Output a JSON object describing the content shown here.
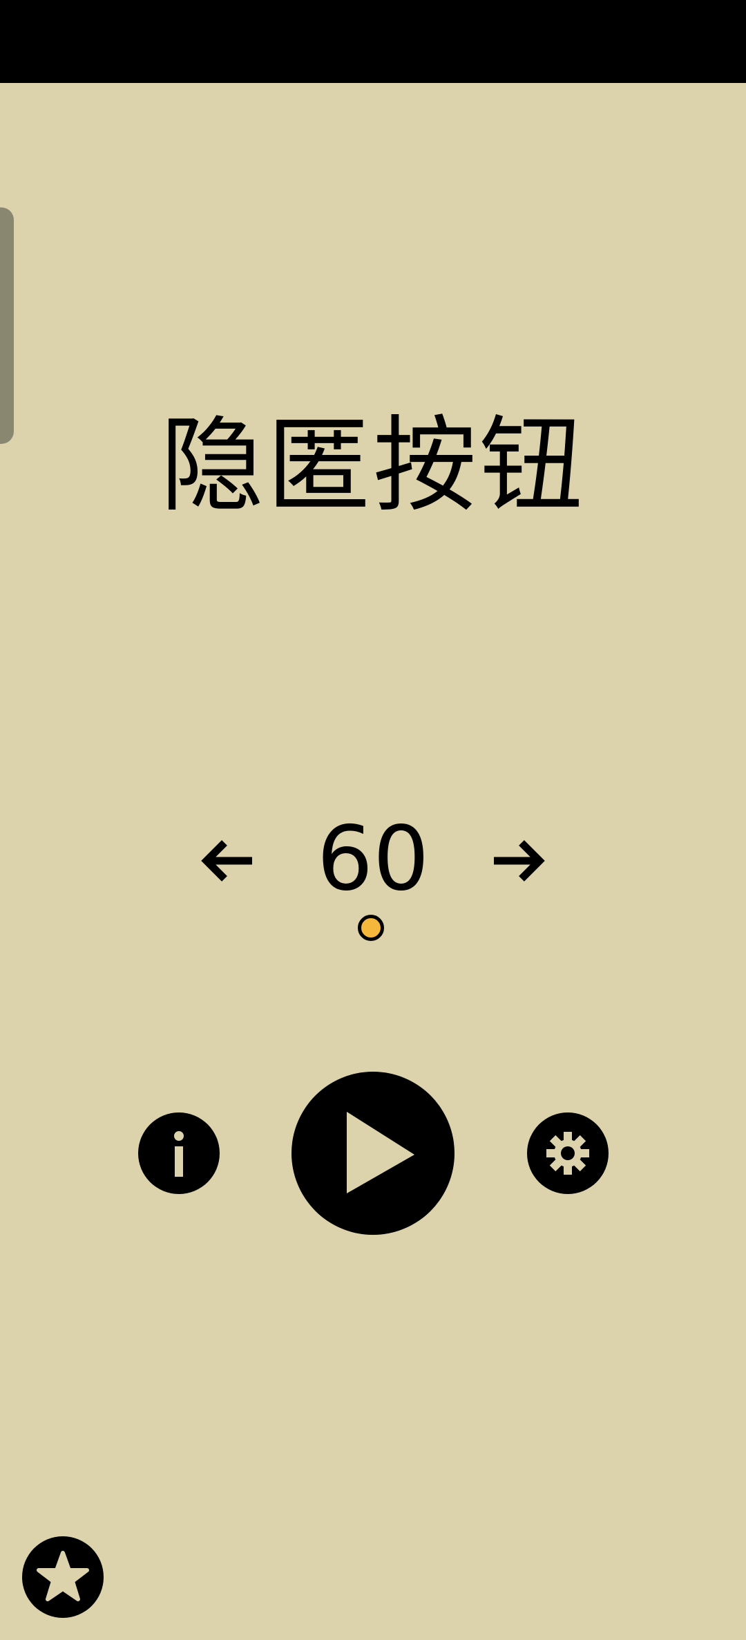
{
  "title": "隐匿按钮",
  "level": {
    "number": "60"
  },
  "colors": {
    "background": "#dcd3ad",
    "ink": "#000000",
    "accent_dot": "#f5b73c",
    "side_tab": "#8a8770"
  },
  "icons": {
    "prev": "arrow-left-icon",
    "next": "arrow-right-icon",
    "info": "info-icon",
    "play": "play-icon",
    "settings": "gear-icon",
    "favorite": "star-icon"
  }
}
